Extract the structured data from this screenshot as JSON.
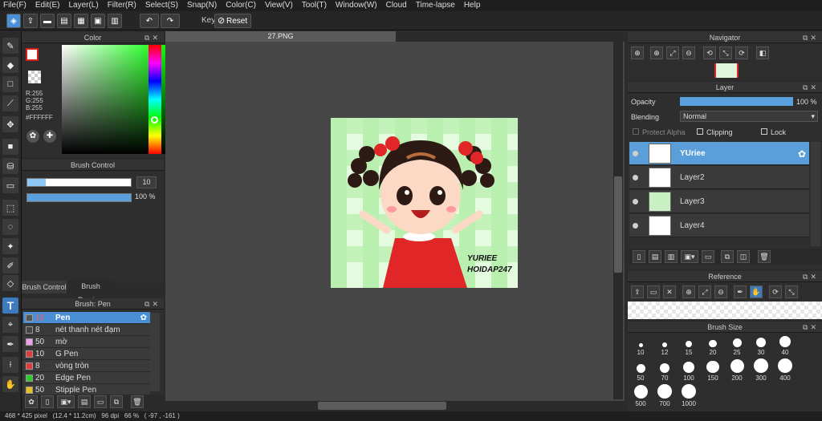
{
  "menu": [
    "File(F)",
    "Edit(E)",
    "Layer(L)",
    "Filter(R)",
    "Select(S)",
    "Snap(N)",
    "Color(C)",
    "View(V)",
    "Tool(T)",
    "Window(W)",
    "Cloud",
    "Time-lapse",
    "Help"
  ],
  "toolbar": {
    "key_label": "Key",
    "reset_label": "Reset"
  },
  "color_panel": {
    "title": "Color",
    "rgb": [
      "R:255",
      "G:255",
      "B:255"
    ],
    "hex": "#FFFFFF",
    "fg": "#ffffff",
    "fg_border": "#e0201b"
  },
  "brush_control": {
    "title": "Brush Control",
    "size": "10",
    "opacity": "100 %",
    "size_fill": 0.18,
    "opacity_fill": 1.0,
    "tab_control": "Brush Control",
    "tab_preview": "Brush Preview"
  },
  "brush_list": {
    "title": "Brush: Pen",
    "items": [
      {
        "size": "10",
        "name": "Pen",
        "color": "#555555",
        "selected": true
      },
      {
        "size": "8",
        "name": "nét thanh nét đạm",
        "color": "#444444"
      },
      {
        "size": "50",
        "name": "mờ",
        "color": "#f0a0e8"
      },
      {
        "size": "10",
        "name": "G Pen",
        "color": "#e03a3a"
      },
      {
        "size": "8",
        "name": "vòng tròn",
        "color": "#e03a3a"
      },
      {
        "size": "20",
        "name": "Edge Pen",
        "color": "#2ecc2e"
      },
      {
        "size": "50",
        "name": "Stipple Pen",
        "color": "#e8c020"
      }
    ]
  },
  "document": {
    "tab": "27.PNG",
    "canvas_bg": "#ffffff",
    "watermark_line1": "YURIEE",
    "watermark_line2": "HOIDAP247"
  },
  "status": "468 * 425 pixel   (12.4 * 11.2cm)   96 dpi   66 %   ( -97 , -161 )",
  "navigator": {
    "title": "Navigator"
  },
  "layer_panel": {
    "title": "Layer",
    "opacity_label": "Opacity",
    "opacity_value": "100 %",
    "opacity_fill": 1.0,
    "blending_label": "Blending",
    "blending_value": "Normal",
    "protect_alpha": "Protect Alpha",
    "clipping": "Clipping",
    "lock": "Lock",
    "layers": [
      {
        "name": "YUriee",
        "selected": true
      },
      {
        "name": "Layer2"
      },
      {
        "name": "Layer3"
      },
      {
        "name": "Layer4"
      }
    ]
  },
  "reference": {
    "title": "Reference"
  },
  "brush_size": {
    "title": "Brush Size",
    "sizes": [
      "10",
      "12",
      "15",
      "20",
      "25",
      "30",
      "40",
      "50",
      "70",
      "100",
      "150",
      "200",
      "300",
      "400",
      "500",
      "700",
      "1000"
    ]
  }
}
